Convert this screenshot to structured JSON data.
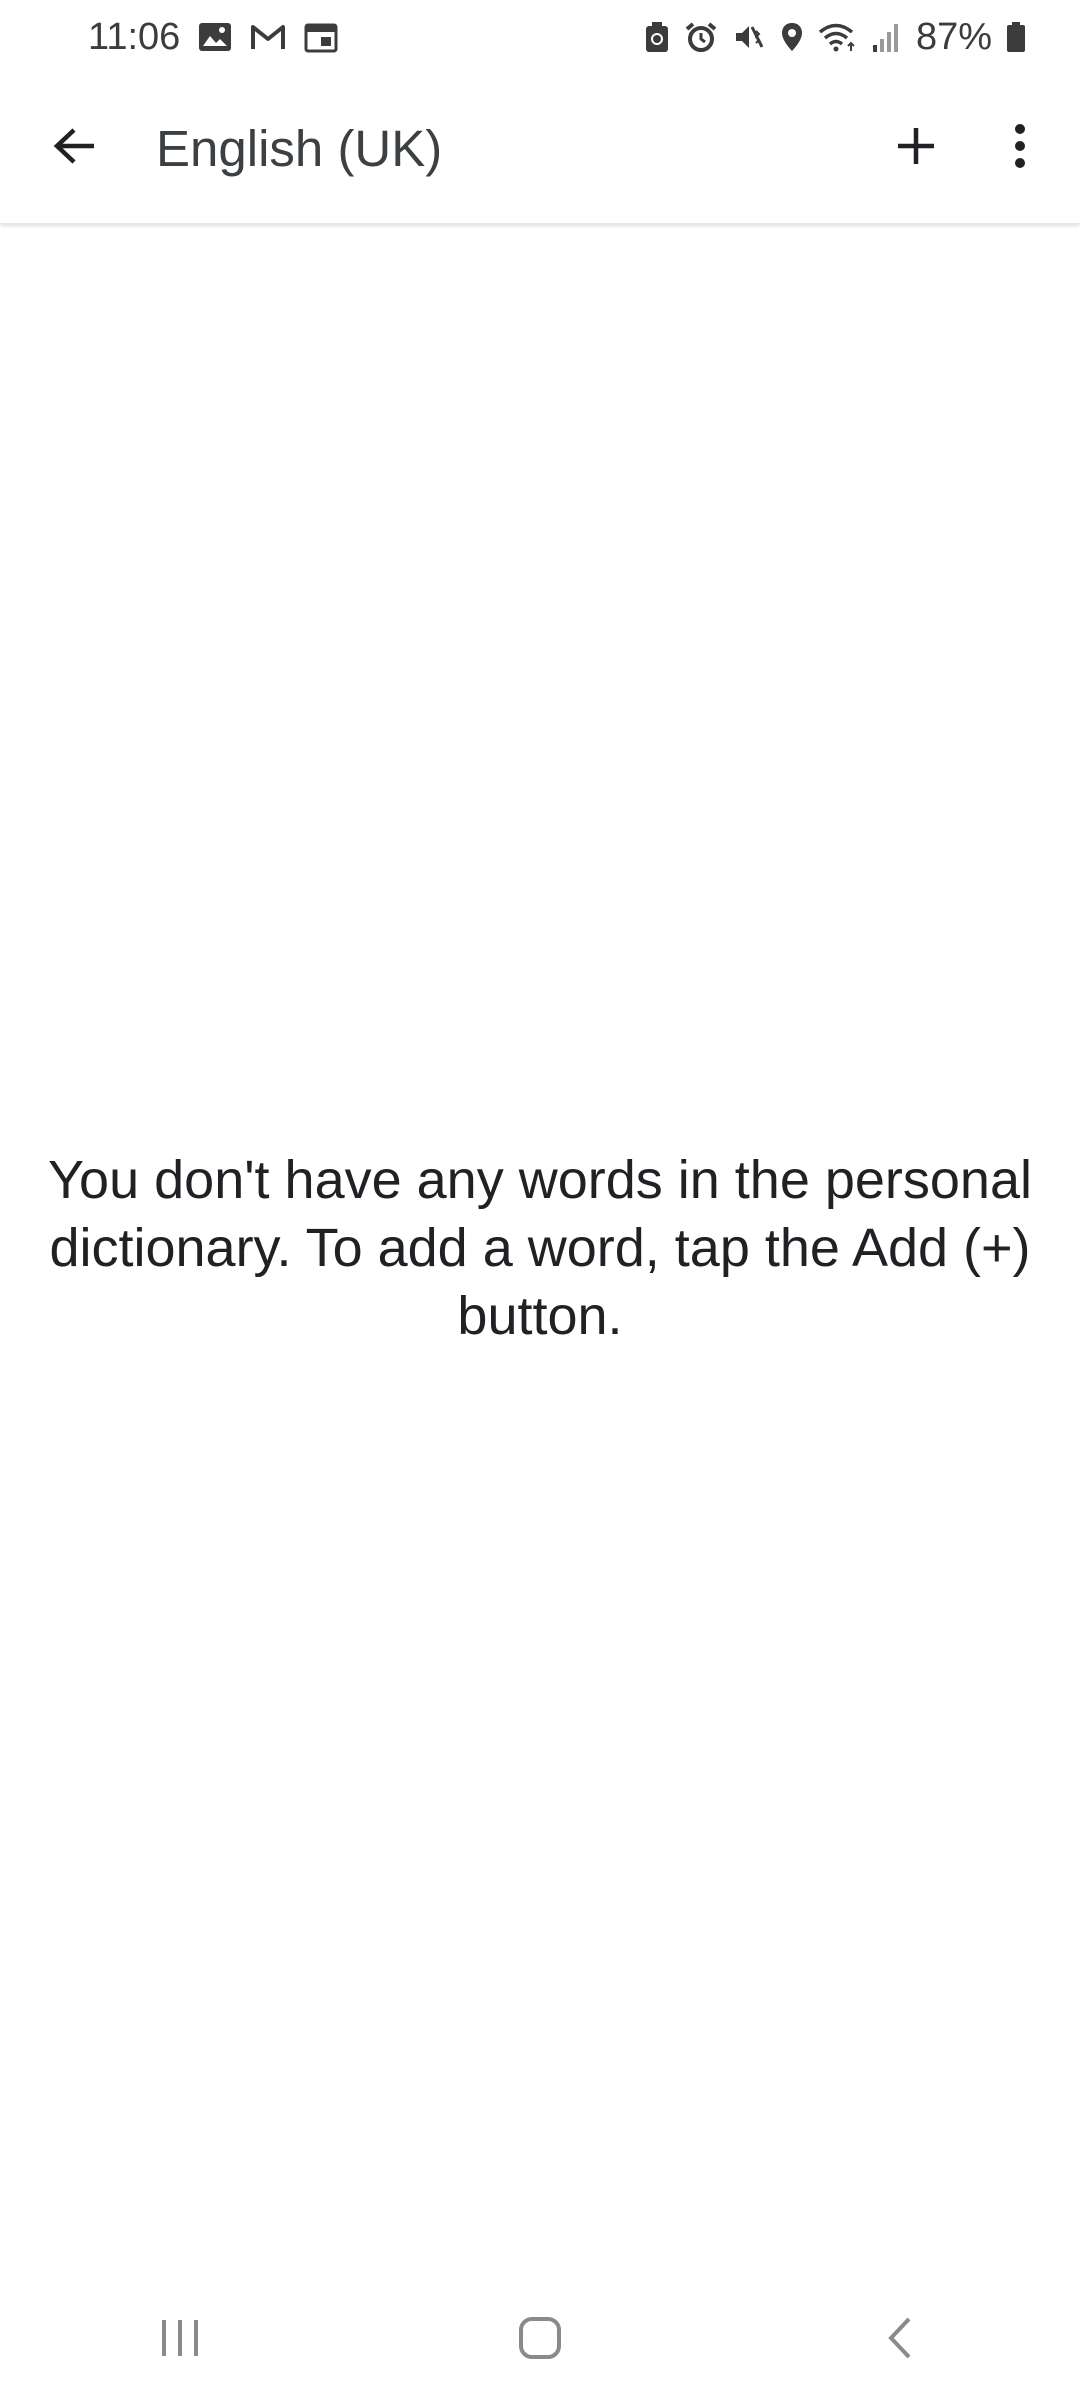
{
  "status_bar": {
    "time": "11:06",
    "battery_percent": "87%",
    "left_icons": [
      "gallery-icon",
      "gmail-icon",
      "calendar-icon"
    ],
    "right_icons": [
      "battery-saver-icon",
      "alarm-icon",
      "vibrate-mute-icon",
      "location-icon",
      "wifi-icon",
      "signal-icon",
      "battery-icon"
    ]
  },
  "app_bar": {
    "title": "English (UK)",
    "back_icon": "arrow-back-icon",
    "add_icon": "plus-icon",
    "more_icon": "more-vert-icon"
  },
  "main": {
    "empty_message": "You don't have any words in the personal dictionary. To add a word, tap the Add (+) button."
  },
  "nav_bar": {
    "recents_icon": "recents-icon",
    "home_icon": "home-icon",
    "back_icon": "nav-back-icon"
  },
  "colors": {
    "text_primary": "#202124",
    "icon": "#3c4043",
    "background": "#ffffff",
    "nav_icon": "#8a8a8a"
  }
}
